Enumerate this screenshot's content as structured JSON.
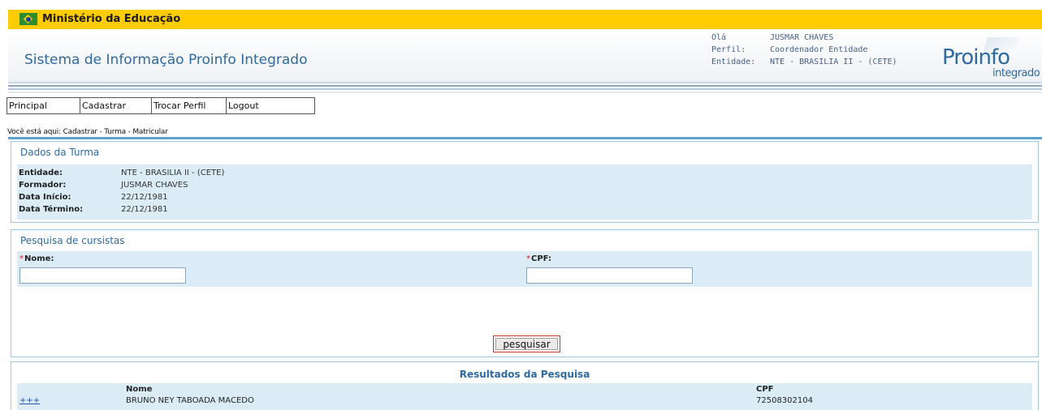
{
  "gov_bar": {
    "title": "Ministério da Educação"
  },
  "header": {
    "system_title": "Sistema de Informação Proinfo Integrado",
    "user": {
      "greeting_label": "Olá",
      "name": "JUSMAR CHAVES",
      "profile_label": "Perfil:",
      "profile": "Coordenador Entidade",
      "entity_label": "Entidade:",
      "entity": "NTE - BRASILIA II - (CETE)"
    },
    "logo": {
      "main": "Proinfo",
      "sub": "integrado"
    }
  },
  "menu": {
    "items": [
      {
        "label": "Principal"
      },
      {
        "label": "Cadastrar"
      },
      {
        "label": "Trocar Perfil"
      },
      {
        "label": "Logout"
      }
    ]
  },
  "breadcrumb": "Você está aqui: Cadastrar - Turma - Matricular",
  "turma": {
    "title": "Dados da Turma",
    "rows": [
      {
        "label": "Entidade:",
        "value": "NTE - BRASILIA II - (CETE)"
      },
      {
        "label": "Formador:",
        "value": "JUSMAR CHAVES"
      },
      {
        "label": "Data Início:",
        "value": "22/12/1981"
      },
      {
        "label": "Data Término:",
        "value": "22/12/1981"
      }
    ]
  },
  "search": {
    "title": "Pesquisa de cursistas",
    "required_mark": "*",
    "name_label": "Nome:",
    "name_value": "",
    "cpf_label": "CPF:",
    "cpf_value": "",
    "button_label": "pesquisar"
  },
  "results": {
    "title": "Resultados da Pesquisa",
    "col_name": "Nome",
    "col_cpf": "CPF",
    "rows": [
      {
        "action": "+++",
        "name": "BRUNO NEY TABOADA MACEDO",
        "cpf": "72508302104"
      }
    ]
  },
  "colors": {
    "gov_bar": "#ffcc00",
    "accent_blue": "#2e6aa0",
    "panel_band": "#dbecf6",
    "panel_border": "#9fc7df",
    "required_red": "#cc2222"
  }
}
